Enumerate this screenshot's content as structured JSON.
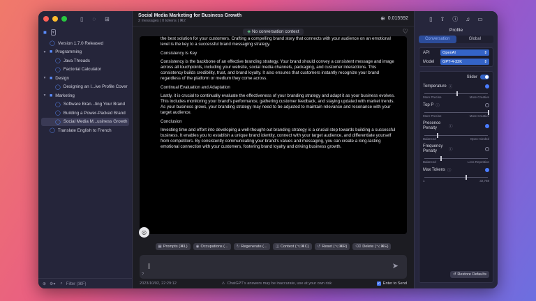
{
  "sidebar": {
    "items": [
      {
        "type": "chat",
        "label": "Version 1.7.0 Released",
        "level": 0
      },
      {
        "type": "folder",
        "label": "Programming",
        "level": 0
      },
      {
        "type": "chat",
        "label": "Java Threads",
        "level": 1
      },
      {
        "type": "chat",
        "label": "Factorial Calculator",
        "level": 1
      },
      {
        "type": "folder",
        "label": "Design",
        "level": 0
      },
      {
        "type": "chat",
        "label": "Designing an I...ive Profile Cover",
        "level": 1
      },
      {
        "type": "folder",
        "label": "Marketing",
        "level": 0
      },
      {
        "type": "chat",
        "label": "Software Bran...ting Your Brand",
        "level": 1
      },
      {
        "type": "chat",
        "label": "Building a Power-Packed Brand",
        "level": 1
      },
      {
        "type": "chat",
        "label": "Social Media M...usiness Growth",
        "level": 1,
        "selected": true
      },
      {
        "type": "chat",
        "label": "Translate English to French",
        "level": 0
      }
    ],
    "filter_placeholder": "Filter (⌘F)"
  },
  "header": {
    "title": "Social Media Marketing for Business Growth",
    "subtitle": "2 messages  |  0 tokens  |  ⌘2",
    "cost": "0.015592"
  },
  "context_pill": "No conversation context",
  "message": {
    "paragraphs": [
      "the best solution for your customers. Crafting a compelling brand story that connects with your audience on an emotional level is the key to a successful brand messaging strategy.",
      "Consistency is Key",
      "Consistency is the backbone of an effective branding strategy. Your brand should convey a consistent message and image across all touchpoints, including your website, social media channels, packaging, and customer interactions. This consistency builds credibility, trust, and brand loyalty. It also ensures that customers instantly recognize your brand regardless of the platform or medium they come across.",
      "Continual Evaluation and Adaptation",
      "Lastly, it is crucial to continually evaluate the effectiveness of your branding strategy and adapt it as your business evolves. This includes monitoring your brand's performance, gathering customer feedback, and staying updated with market trends. As your business grows, your branding strategy may need to be adjusted to maintain relevance and resonance with your target audience.",
      "Conclusion",
      "Investing time and effort into developing a well-thought-out branding strategy is a crucial step towards building a successful business. It enables you to establish a unique brand identity, connect with your target audience, and differentiate yourself from competitors. By consistently communicating your brand's values and messaging, you can create a long-lasting emotional connection with your customers, fostering brand loyalty and driving business growth."
    ]
  },
  "actions": [
    {
      "label": "Prompts (⌘L)",
      "icon": "grid-icon"
    },
    {
      "label": "Occupations (...",
      "icon": "person-icon"
    },
    {
      "label": "Regenerate (...",
      "icon": "refresh-icon"
    },
    {
      "label": "Context (⌥⌘C)",
      "icon": "context-icon"
    },
    {
      "label": "Reset (⌥⌘R)",
      "icon": "reset-icon"
    },
    {
      "label": "Delete (⌥⌘E)",
      "icon": "trash-icon"
    }
  ],
  "footer": {
    "timestamp": "2023/10/02, 22:29:12",
    "warning": "ChatGPT's answers may be inaccurate, use at your own risk",
    "enter_to_send": "Enter to Send"
  },
  "right_panel": {
    "title": "Profile",
    "tabs": [
      "Conversation",
      "Global"
    ],
    "active_tab": 0,
    "api_label": "API",
    "api_value": "OpenAI",
    "model_label": "Model",
    "model_value": "GPT-4-32K",
    "slider_label": "Slider",
    "params": [
      {
        "label": "Temperature",
        "min_label": "More Precise",
        "max_label": "More Creative",
        "value": 0.5,
        "indicator": "dot"
      },
      {
        "label": "Top P",
        "min_label": "More Precise",
        "max_label": "More Creative",
        "value": 1.0,
        "indicator": "ring"
      },
      {
        "label": "Presence Penalty",
        "min_label": "Balanced",
        "max_label": "Open-minded",
        "value": 0.2,
        "indicator": "dot"
      },
      {
        "label": "Frequency Penalty",
        "min_label": "Balanced",
        "max_label": "Less Repetition",
        "value": 0.25,
        "indicator": "ring"
      },
      {
        "label": "Max Tokens",
        "min_label": "1",
        "max_label": "32,768",
        "value": 0.65,
        "indicator": "dot"
      }
    ],
    "restore_label": "Restore Defaults"
  },
  "colors": {
    "accent": "#4a7cff",
    "sidebar_bg": "#25253a",
    "panel_bg": "#26263c"
  }
}
